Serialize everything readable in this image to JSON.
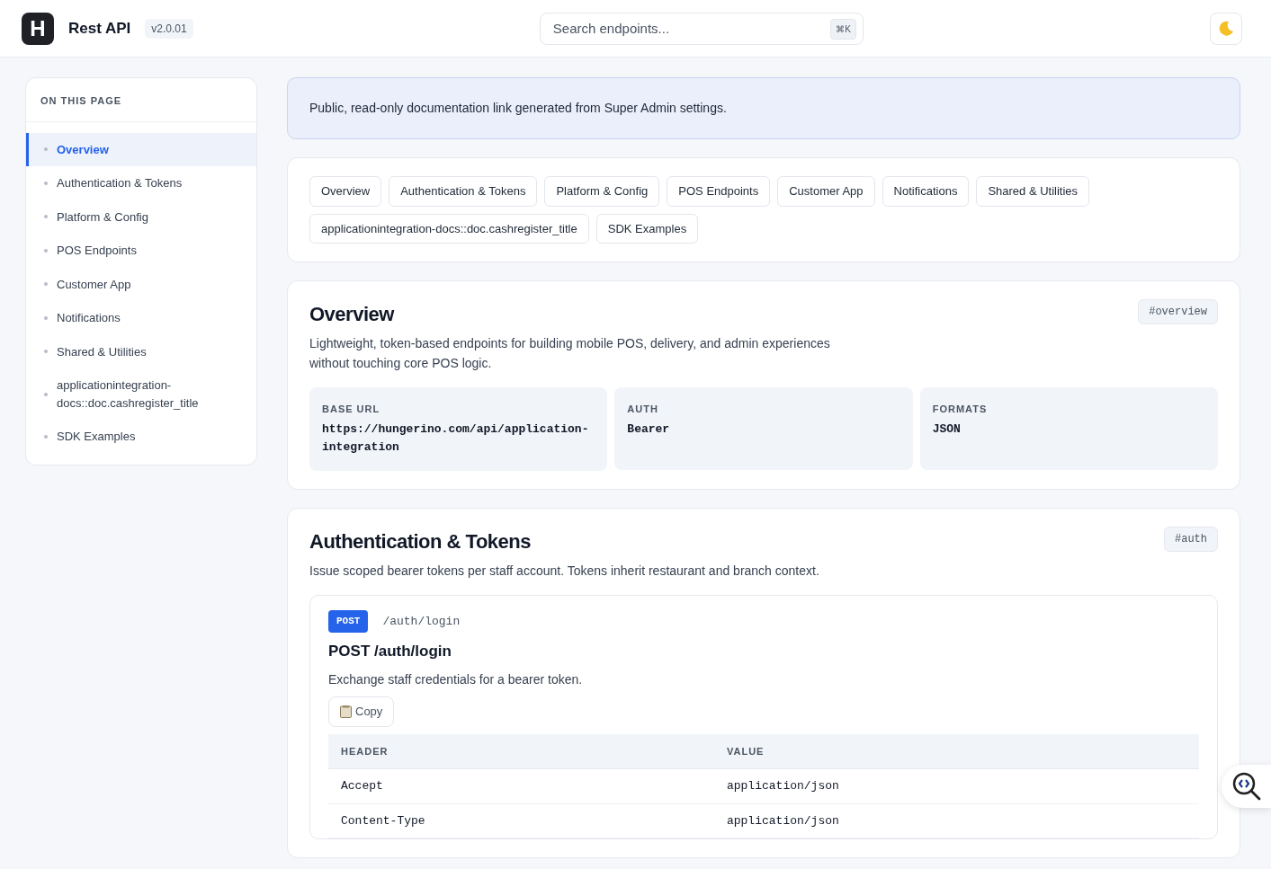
{
  "header": {
    "logo_text": "H",
    "title": "Rest API",
    "version": "v2.0.01",
    "search": {
      "placeholder": "Search endpoints...",
      "shortcut": "⌘K"
    }
  },
  "sidebar": {
    "heading": "ON THIS PAGE",
    "items": [
      {
        "label": "Overview",
        "selected": true
      },
      {
        "label": "Authentication & Tokens",
        "selected": false
      },
      {
        "label": "Platform & Config",
        "selected": false
      },
      {
        "label": "POS Endpoints",
        "selected": false
      },
      {
        "label": "Customer App",
        "selected": false
      },
      {
        "label": "Notifications",
        "selected": false
      },
      {
        "label": "Shared & Utilities",
        "selected": false
      },
      {
        "label": "applicationintegration-docs::doc.cashregister_title",
        "selected": false
      },
      {
        "label": "SDK Examples",
        "selected": false
      }
    ]
  },
  "notice": "Public, read-only documentation link generated from Super Admin settings.",
  "section_links": [
    "Overview",
    "Authentication & Tokens",
    "Platform & Config",
    "POS Endpoints",
    "Customer App",
    "Notifications",
    "Shared & Utilities",
    "applicationintegration-docs::doc.cashregister_title",
    "SDK Examples"
  ],
  "sections": [
    {
      "title": "Overview",
      "anchor": "#overview",
      "description": "Lightweight, token-based endpoints for building mobile POS, delivery, and admin experiences without touching core POS logic.",
      "facts": [
        {
          "label": "BASE URL",
          "value": "https://hungerino.com/api/application-integration"
        },
        {
          "label": "AUTH",
          "value": "Bearer"
        },
        {
          "label": "FORMATS",
          "value": "JSON"
        }
      ]
    },
    {
      "title": "Authentication & Tokens",
      "anchor": "#auth",
      "description": "Issue scoped bearer tokens per staff account. Tokens inherit restaurant and branch context.",
      "endpoints": [
        {
          "method": "POST",
          "path": "/auth/login",
          "title": "POST /auth/login",
          "description": "Exchange staff credentials for a bearer token.",
          "copy_label": "Copy",
          "table": {
            "columns": [
              "HEADER",
              "VALUE"
            ],
            "rows": [
              [
                "Accept",
                "application/json"
              ],
              [
                "Content-Type",
                "application/json"
              ]
            ]
          }
        }
      ]
    }
  ]
}
